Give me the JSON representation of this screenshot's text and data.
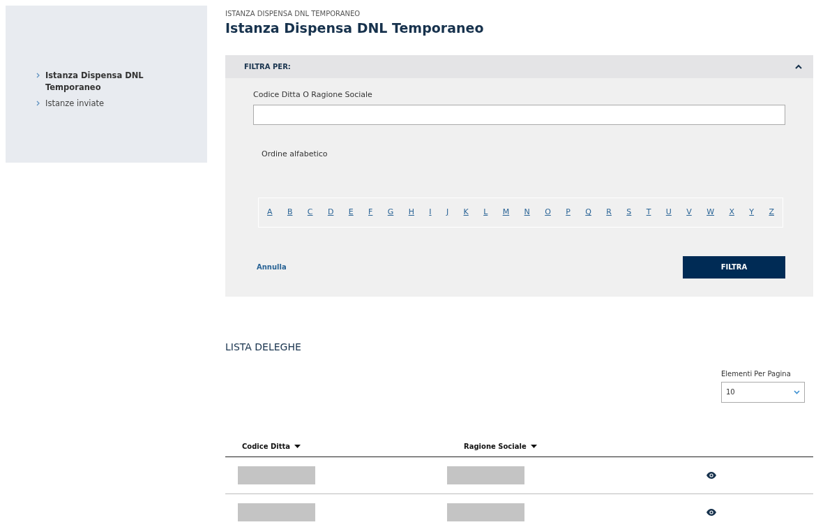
{
  "sidebar": {
    "items": [
      {
        "label": "Istanza Dispensa DNL Temporaneo",
        "selected": true
      },
      {
        "label": "Istanze inviate",
        "selected": false
      }
    ]
  },
  "breadcrumb": "ISTANZA DISPENSA DNL TEMPORANEO",
  "title": "Istanza Dispensa DNL Temporaneo",
  "filter": {
    "header": "FILTRA PER:",
    "expanded": true,
    "field_label": "Codice Ditta O Ragione Sociale",
    "alpha_label": "Ordine alfabetico",
    "letters": [
      "A",
      "B",
      "C",
      "D",
      "E",
      "F",
      "G",
      "H",
      "I",
      "J",
      "K",
      "L",
      "M",
      "N",
      "O",
      "P",
      "Q",
      "R",
      "S",
      "T",
      "U",
      "V",
      "W",
      "X",
      "Y",
      "Z"
    ],
    "cancel": "Annulla",
    "submit": "FILTRA"
  },
  "list": {
    "title": "LISTA DELEGHE",
    "page_size_label": "Elementi Per Pagina",
    "page_size": "10",
    "columns": [
      "Codice Ditta",
      "Ragione Sociale"
    ],
    "rows": [
      {
        "kind": "redacted"
      },
      {
        "kind": "redacted"
      }
    ]
  }
}
